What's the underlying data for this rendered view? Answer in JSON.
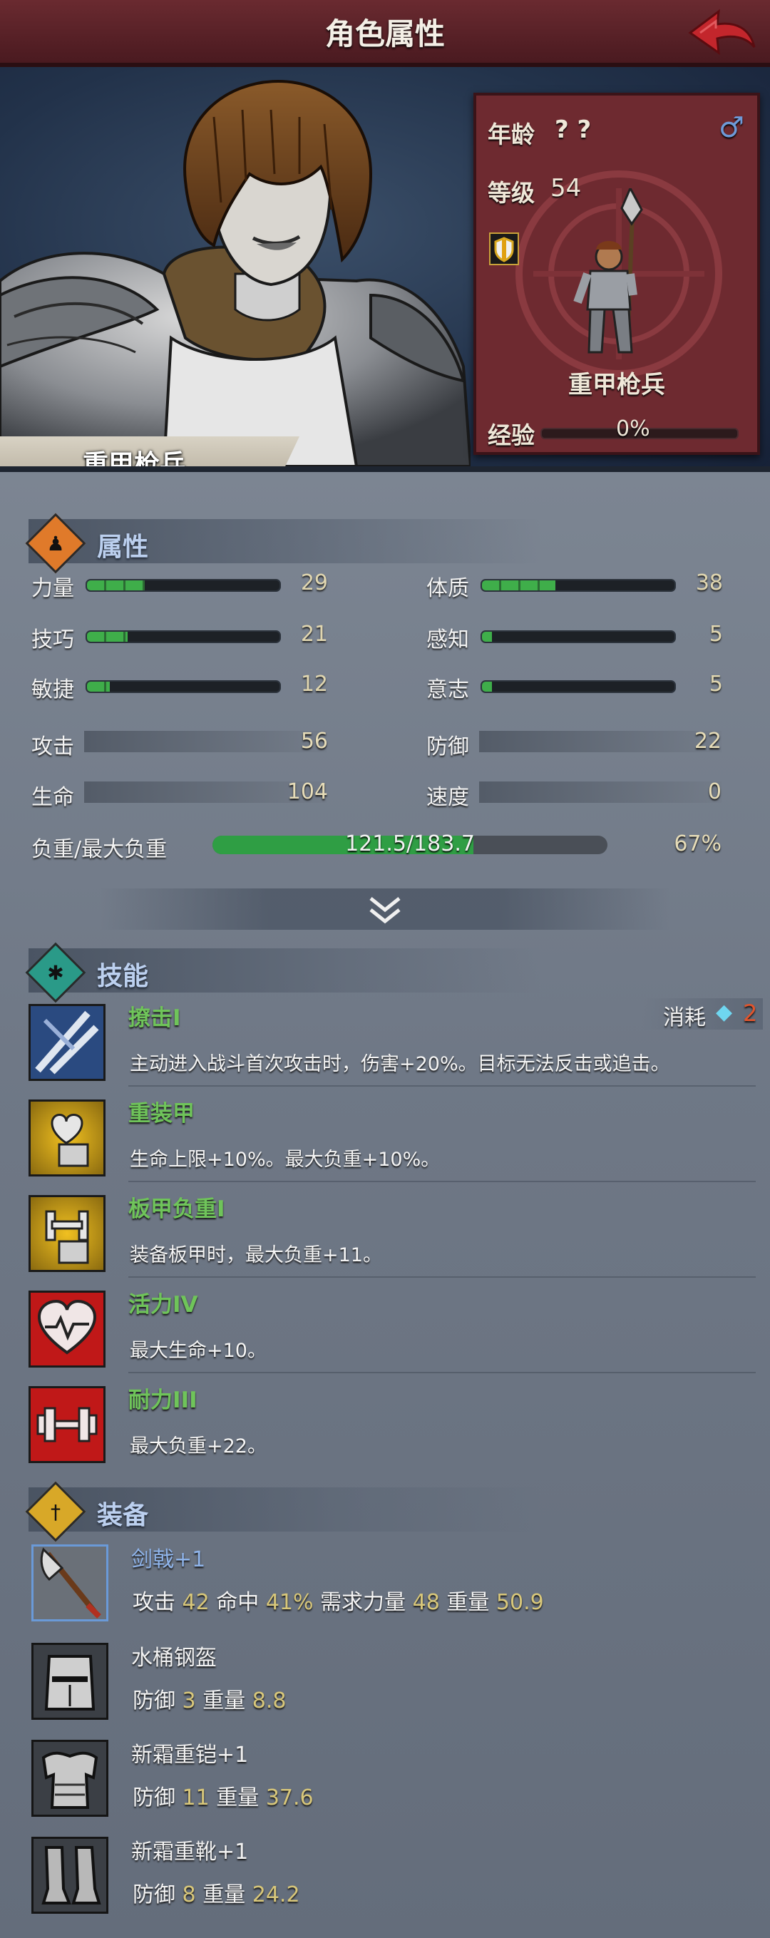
{
  "header": {
    "title": "角色属性"
  },
  "hero": {
    "unit_name": "重甲枪兵",
    "card": {
      "age_label": "年龄",
      "age_value": "? ?",
      "level_label": "等级",
      "level_value": "54",
      "class_name": "重甲枪兵",
      "exp_label": "经验",
      "exp_value": "0%",
      "exp_fraction": 0
    }
  },
  "attributes": {
    "title": "属性",
    "stats": [
      {
        "label": "力量",
        "value": "29",
        "fill": 0.3
      },
      {
        "label": "体质",
        "value": "38",
        "fill": 0.38
      },
      {
        "label": "技巧",
        "value": "21",
        "fill": 0.21
      },
      {
        "label": "感知",
        "value": "5",
        "fill": 0.05
      },
      {
        "label": "敏捷",
        "value": "12",
        "fill": 0.12
      },
      {
        "label": "意志",
        "value": "5",
        "fill": 0.05
      }
    ],
    "combat": [
      {
        "label": "攻击",
        "value": "56"
      },
      {
        "label": "防御",
        "value": "22"
      },
      {
        "label": "生命",
        "value": "104"
      },
      {
        "label": "速度",
        "value": "0"
      }
    ],
    "load": {
      "label": "负重/最大负重",
      "value": "121.5/183.7",
      "percent": "67%",
      "fraction": 0.661
    }
  },
  "skills": {
    "title": "技能",
    "cost_label": "消耗",
    "cost_value": "2",
    "items": [
      {
        "name": "撩击I",
        "desc": "主动进入战斗首次攻击时，伤害+20%。目标无法反击或追击。"
      },
      {
        "name": "重装甲",
        "desc": "生命上限+10%。最大负重+10%。"
      },
      {
        "name": "板甲负重I",
        "desc": "装备板甲时，最大负重+11。"
      },
      {
        "name": "活力IV",
        "desc": "最大生命+10。"
      },
      {
        "name": "耐力III",
        "desc": "最大负重+22。"
      }
    ]
  },
  "equipment": {
    "title": "装备",
    "items": [
      {
        "name": "剑戟+1",
        "stats": [
          {
            "k": "攻击",
            "v": "42"
          },
          {
            "k": "命中",
            "v": "41%"
          },
          {
            "k": "需求力量",
            "v": "48"
          },
          {
            "k": "重量",
            "v": "50.9"
          }
        ]
      },
      {
        "name": "水桶钢盔",
        "stats": [
          {
            "k": "防御",
            "v": "3"
          },
          {
            "k": "重量",
            "v": "8.8"
          }
        ]
      },
      {
        "name": "新霜重铠+1",
        "stats": [
          {
            "k": "防御",
            "v": "11"
          },
          {
            "k": "重量",
            "v": "37.6"
          }
        ]
      },
      {
        "name": "新霜重靴+1",
        "stats": [
          {
            "k": "防御",
            "v": "8"
          },
          {
            "k": "重量",
            "v": "24.2"
          }
        ]
      }
    ]
  },
  "colors": {
    "header": "#5a2026",
    "card": "#6e2a30",
    "skill_name": "#6fc45a",
    "first_equipment_name": "#8fb4ea",
    "stat_value": "#e0d6b0",
    "gem": "#6fd6f0",
    "cost_value": "#e0552e"
  },
  "icons": {
    "back": "back-arrow-icon",
    "gender": "male-gender-icon",
    "shield": "shield-badge-icon",
    "attributes": "person-diamond-icon",
    "skills": "star-diamond-icon",
    "equipment": "sword-diamond-icon",
    "expand": "double-chevron-down-icon",
    "cost": "diamond-gem-icon"
  }
}
